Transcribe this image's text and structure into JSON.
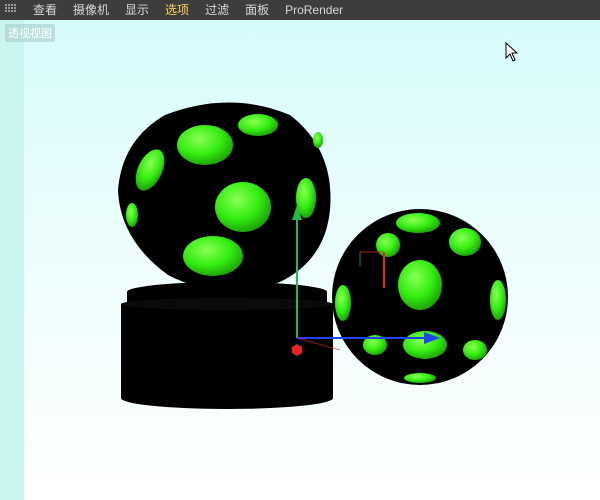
{
  "menu": {
    "items": [
      {
        "label": "查看",
        "active": false
      },
      {
        "label": "摄像机",
        "active": false
      },
      {
        "label": "显示",
        "active": false
      },
      {
        "label": "选项",
        "active": true
      },
      {
        "label": "过滤",
        "active": false
      },
      {
        "label": "面板",
        "active": false
      },
      {
        "label": "ProRender",
        "active": false
      }
    ]
  },
  "viewport": {
    "label": "透视视图"
  },
  "colors": {
    "menubar_bg": "#3d3d3d",
    "active_menu": "#ffd35c",
    "green_spots": "#33ee11",
    "axis_x": "#2244ee",
    "axis_y": "#22bb44",
    "axis_z": "#ee2222"
  }
}
